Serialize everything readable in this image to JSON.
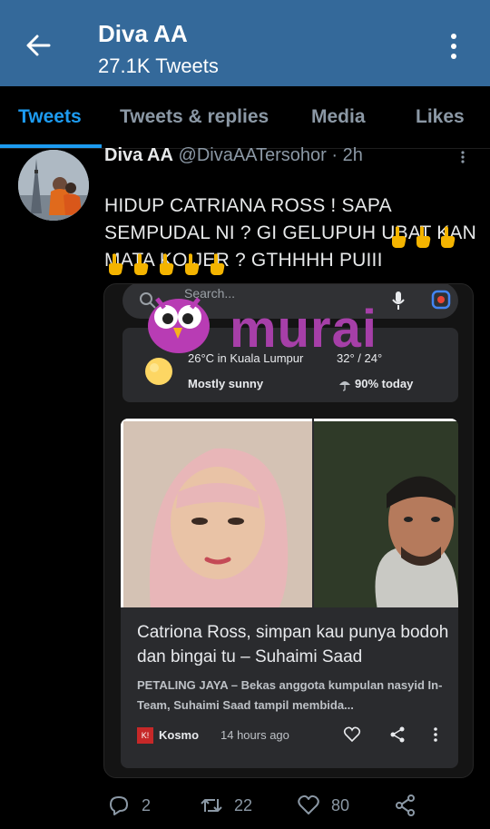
{
  "header": {
    "title": "Diva AA",
    "subtitle": "27.1K Tweets"
  },
  "tabs": [
    {
      "label": "Tweets",
      "active": true
    },
    {
      "label": "Tweets & replies",
      "active": false
    },
    {
      "label": "Media",
      "active": false
    },
    {
      "label": "Likes",
      "active": false
    }
  ],
  "tweet": {
    "name": "Diva AA",
    "handle": "@DivaAATersohor · 2h",
    "text": "HIDUP CATRIANA ROSS ! SAPA SEMPUDAL NI ? GI GELUPUH UBAT KAN MATA KO JER ? GTHHHH PUIII",
    "emoji_count": 8,
    "embed": {
      "search_placeholder": "Search...",
      "watermark": "murai",
      "weather": {
        "temp": "26°C in Kuala Lumpur",
        "hilo": "32° / 24°",
        "condition": "Mostly sunny",
        "rain": "90% today"
      },
      "news": {
        "title": "Catriona Ross, simpan kau punya bodoh dan bingai tu – Suhaimi Saad",
        "snippet": "PETALING JAYA – Bekas anggota kumpulan nasyid In-Team, Suhaimi Saad tampil membida...",
        "source_logo": "K!",
        "source": "Kosmo",
        "time": "14 hours ago"
      }
    },
    "stats": {
      "replies": "2",
      "retweets": "22",
      "likes": "80"
    }
  },
  "colors": {
    "header_bg": "#34699a",
    "accent": "#1d9bf0",
    "watermark": "#a63fa8"
  }
}
